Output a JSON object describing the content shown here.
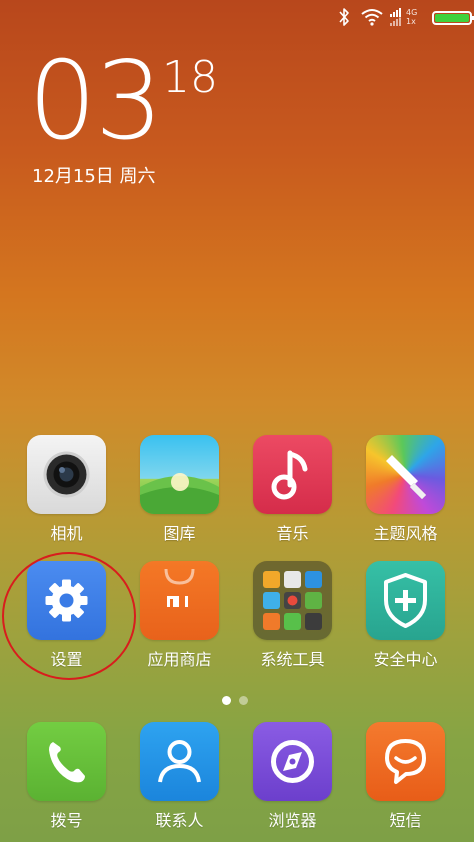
{
  "status_bar": {
    "network_top": "4G",
    "network_bottom": "1x"
  },
  "lock": {
    "hour": "03",
    "minute": "18",
    "date": "12月15日 周六"
  },
  "apps": [
    {
      "id": "camera",
      "label": "相机",
      "icon": "camera-icon"
    },
    {
      "id": "gallery",
      "label": "图库",
      "icon": "gallery-icon"
    },
    {
      "id": "music",
      "label": "音乐",
      "icon": "music-note-icon"
    },
    {
      "id": "themes",
      "label": "主题风格",
      "icon": "paintbrush-icon"
    },
    {
      "id": "settings",
      "label": "设置",
      "icon": "gear-icon"
    },
    {
      "id": "appstore",
      "label": "应用商店",
      "icon": "mi-store-icon"
    },
    {
      "id": "tools",
      "label": "系统工具",
      "icon": "folder-icon"
    },
    {
      "id": "security",
      "label": "安全中心",
      "icon": "shield-plus-icon"
    }
  ],
  "dock": [
    {
      "id": "dialer",
      "label": "拨号",
      "icon": "phone-icon"
    },
    {
      "id": "contacts",
      "label": "联系人",
      "icon": "contact-icon"
    },
    {
      "id": "browser",
      "label": "浏览器",
      "icon": "browser-icon"
    },
    {
      "id": "messages",
      "label": "短信",
      "icon": "chat-bubble-icon"
    }
  ],
  "page_indicator": {
    "pages": 2,
    "current": 1
  },
  "colors": {
    "settings_bg": "#3d7ee6",
    "music_bg": "#e03a55",
    "appstore_bg": "#ee6b1c",
    "security_bg": "#2fb39d",
    "dialer_bg": "#67c13a",
    "contacts_bg": "#2295e8",
    "browser_bg": "#7b4fd8",
    "messages_bg": "#f06a22",
    "annotation": "#d81d1d"
  }
}
